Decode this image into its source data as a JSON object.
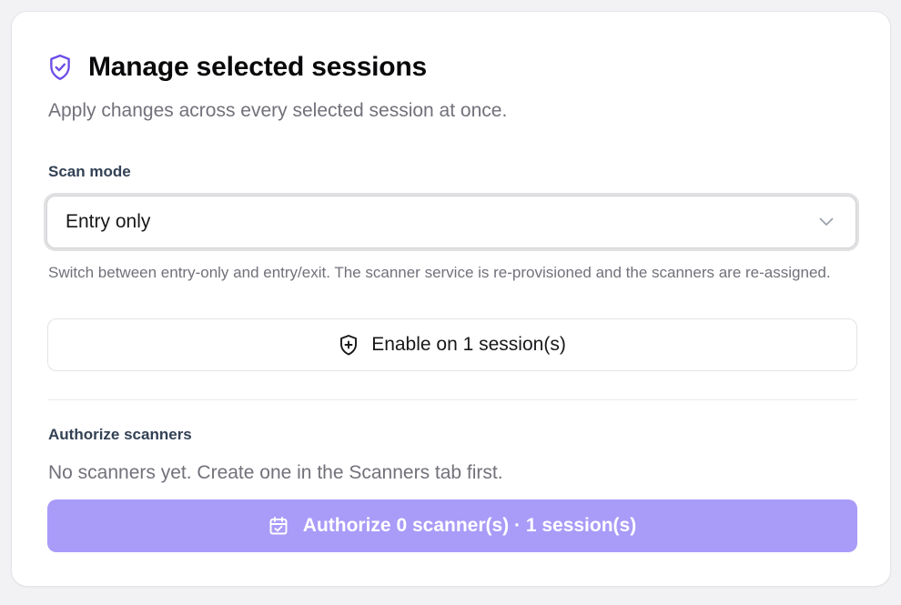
{
  "panel": {
    "title": "Manage selected sessions",
    "title_icon": "shield-check-icon",
    "subtitle": "Apply changes across every selected session at once."
  },
  "scan_mode": {
    "label": "Scan mode",
    "selected": "Entry only",
    "help": "Switch between entry-only and entry/exit. The scanner service is re-provisioned and the scanners are re-assigned.",
    "enable_button": {
      "label": "Enable on 1 session(s)",
      "icon": "shield-plus-icon"
    }
  },
  "authorize": {
    "label": "Authorize scanners",
    "empty_text": "No scanners yet. Create one in the Scanners tab first.",
    "button": {
      "label": "Authorize 0 scanner(s) · 1 session(s)",
      "icon": "calendar-check-icon",
      "disabled": true
    }
  },
  "colors": {
    "accent": "#6d4ee6",
    "primary_disabled": "#a99bf8",
    "muted_text": "#71717a",
    "label_text": "#334155"
  }
}
